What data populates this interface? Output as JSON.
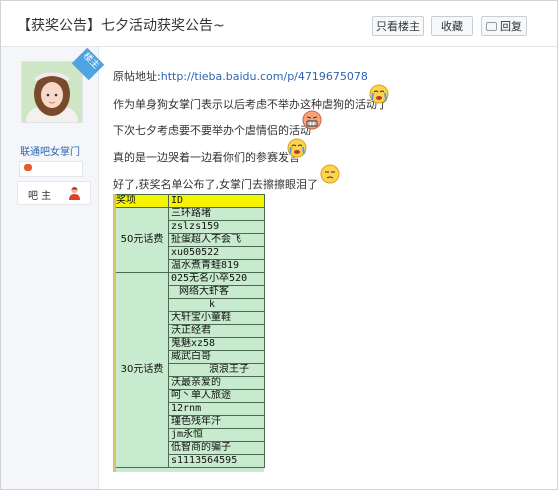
{
  "header": {
    "title": "【获奖公告】七夕活动获奖公告~",
    "only_owner_label": "只看楼主",
    "favorite_label": "收藏",
    "reply_label": "回复"
  },
  "author": {
    "badge": "楼主",
    "username": "联通吧女掌门",
    "role_label": "吧 主"
  },
  "post": {
    "source_prefix": "原帖地址:",
    "source_link": "http://tieba.baidu.com/p/4719675078",
    "line1": "作为单身狗女掌门表示以后考虑不举办这种虐狗的活动了",
    "line2": "下次七夕考虑要不要举办个虐情侣的活动",
    "line3": "真的是一边哭着一边看你们的参赛发言",
    "line4": "好了,获奖名单公布了,女掌门去擦擦眼泪了"
  },
  "table": {
    "headers": [
      "奖项",
      "ID"
    ],
    "groups": [
      {
        "prize": "50元话费",
        "ids": [
          "三环路堵",
          "zslzs159",
          "扯蛋超人不会飞",
          "xu050522",
          "温水煮青蛙819"
        ]
      },
      {
        "prize": "30元话费",
        "ids": [
          "025无名小卒520",
          "网络大虾客",
          "k",
          "大轩宝小童鞋",
          "沃正经君",
          "鬼魅xz58",
          "威武白哥",
          "浪浪王子",
          "沃最亲爱的",
          "呵丶单人旅途",
          "12rnm",
          "瑾色残年汘",
          "jm永恒",
          "低智商的骗子",
          "s1113564595"
        ]
      }
    ]
  },
  "icons": {
    "reply": "reply-icon",
    "emoji1": "crying-face-icon",
    "emoji2": "angry-face-icon",
    "emoji3": "crying-face-icon",
    "emoji4": "sighing-face-icon",
    "role": "user-avatar-icon",
    "level": "game-controller-icon"
  }
}
